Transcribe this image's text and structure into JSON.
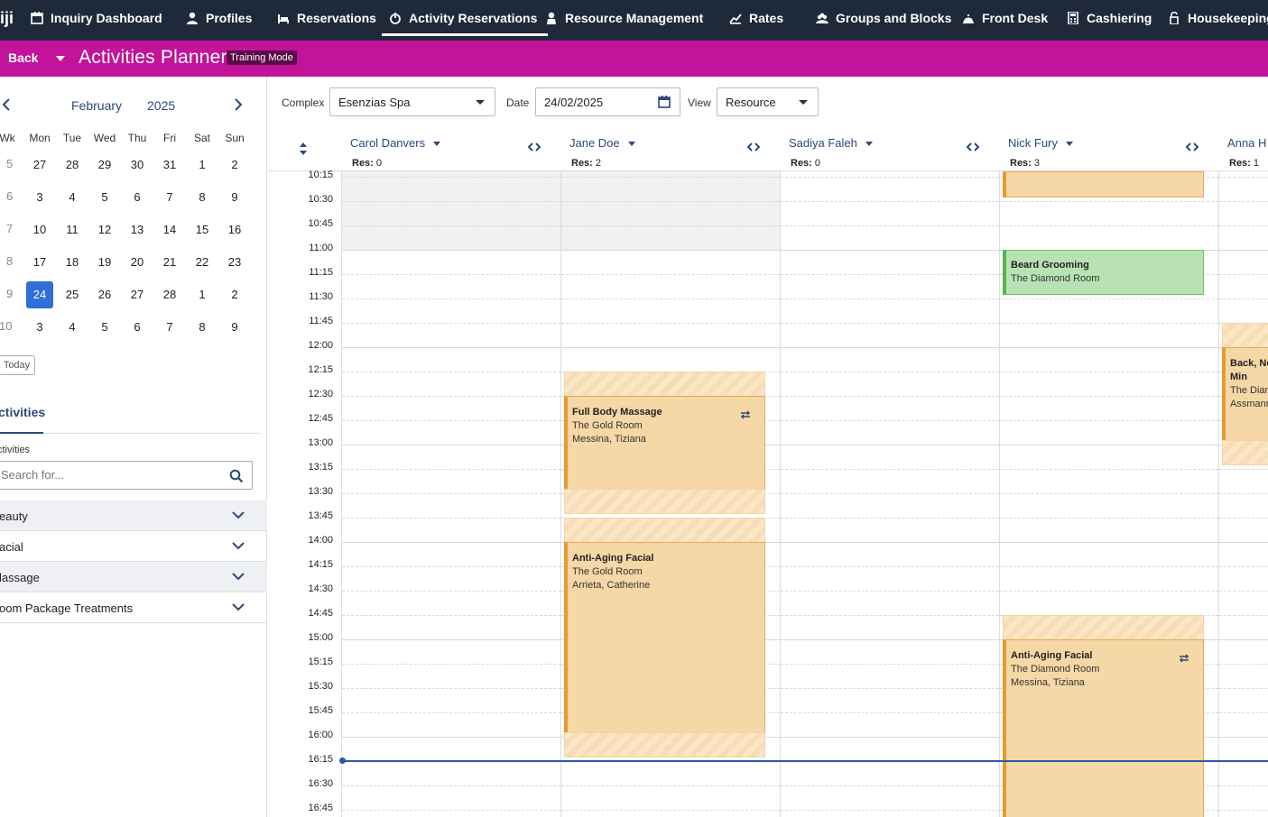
{
  "nav": {
    "logo": "iji",
    "items": [
      {
        "label": "Inquiry Dashboard",
        "icon": "calendar-icon"
      },
      {
        "label": "Profiles",
        "icon": "person-icon"
      },
      {
        "label": "Reservations",
        "icon": "bed-icon"
      },
      {
        "label": "Activity Reservations",
        "icon": "activity-icon"
      },
      {
        "label": "Resource Management",
        "icon": "person-icon"
      },
      {
        "label": "Rates",
        "icon": "rates-icon"
      },
      {
        "label": "Groups and Blocks",
        "icon": "group-icon"
      },
      {
        "label": "Front Desk",
        "icon": "bell-icon"
      },
      {
        "label": "Cashiering",
        "icon": "calculator-icon"
      },
      {
        "label": "Housekeeping",
        "icon": "housekeeping-icon"
      }
    ],
    "active": "Activity Reservations"
  },
  "titlebar": {
    "back_label": "Back",
    "title": "Activities Planner",
    "badge": "Training Mode"
  },
  "calendar": {
    "month": "February",
    "year": "2025",
    "week_header": "Wk",
    "days": [
      "Mon",
      "Tue",
      "Wed",
      "Thu",
      "Fri",
      "Sat",
      "Sun"
    ],
    "weeks": [
      {
        "wk": "5",
        "dates": [
          "27",
          "28",
          "29",
          "30",
          "31",
          "1",
          "2"
        ]
      },
      {
        "wk": "6",
        "dates": [
          "3",
          "4",
          "5",
          "6",
          "7",
          "8",
          "9"
        ]
      },
      {
        "wk": "7",
        "dates": [
          "10",
          "11",
          "12",
          "13",
          "14",
          "15",
          "16"
        ]
      },
      {
        "wk": "8",
        "dates": [
          "17",
          "18",
          "19",
          "20",
          "21",
          "22",
          "23"
        ]
      },
      {
        "wk": "9",
        "dates": [
          "24",
          "25",
          "26",
          "27",
          "28",
          "1",
          "2"
        ]
      },
      {
        "wk": "10",
        "dates": [
          "3",
          "4",
          "5",
          "6",
          "7",
          "8",
          "9"
        ]
      }
    ],
    "selected": "24",
    "today_label": "Today"
  },
  "activities": {
    "tab_label": "ctivities",
    "field_label": "ctivities",
    "search_placeholder": "Search for...",
    "categories": [
      "eauty",
      "acial",
      "lassage",
      "oom Package Treatments"
    ]
  },
  "filters": {
    "complex_label": "Complex",
    "complex_value": "Esenzias Spa",
    "date_label": "Date",
    "date_value": "24/02/2025",
    "view_label": "View",
    "view_value": "Resource"
  },
  "resources": [
    {
      "name": "Carol Danvers",
      "res_label": "Res:",
      "res_count": "0"
    },
    {
      "name": "Jane Doe",
      "res_label": "Res:",
      "res_count": "2"
    },
    {
      "name": "Sadiya Faleh",
      "res_label": "Res:",
      "res_count": "0"
    },
    {
      "name": "Nick Fury",
      "res_label": "Res:",
      "res_count": "3"
    },
    {
      "name": "Anna H",
      "res_label": "Res:",
      "res_count": "1"
    }
  ],
  "times": [
    "10:15",
    "10:30",
    "10:45",
    "11:00",
    "11:15",
    "11:30",
    "11:45",
    "12:00",
    "12:15",
    "12:30",
    "12:45",
    "13:00",
    "13:15",
    "13:30",
    "13:45",
    "14:00",
    "14:15",
    "14:30",
    "14:45",
    "15:00",
    "15:15",
    "15:30",
    "15:45",
    "16:00",
    "16:15",
    "16:30",
    "16:45"
  ],
  "appointments": {
    "a1": {
      "title": "Full Body Massage",
      "room": "The Gold Room",
      "guest": "Messina, Tiziana"
    },
    "a2": {
      "title": "Anti-Aging Facial",
      "room": "The Gold Room",
      "guest": "Arrieta, Catherine"
    },
    "a3": {
      "title": "Beard Grooming",
      "room": "The Diamond Room"
    },
    "a4": {
      "title": "Anti-Aging Facial",
      "room": "The Diamond Room",
      "guest": "Messina, Tiziana"
    },
    "a5": {
      "title_line1": "Back, Ne",
      "title_line2": "Min",
      "room": "The Dian",
      "guest": "Assmann"
    }
  },
  "colors": {
    "nav_bg": "#1e2a3a",
    "titlebar_bg": "#c2139a",
    "accent_blue": "#2b4a7a",
    "selected_day": "#2f6fd6",
    "appt_orange": "#f6d7a6",
    "appt_green": "#b9e2b4",
    "now_line": "#2a5aa6"
  }
}
